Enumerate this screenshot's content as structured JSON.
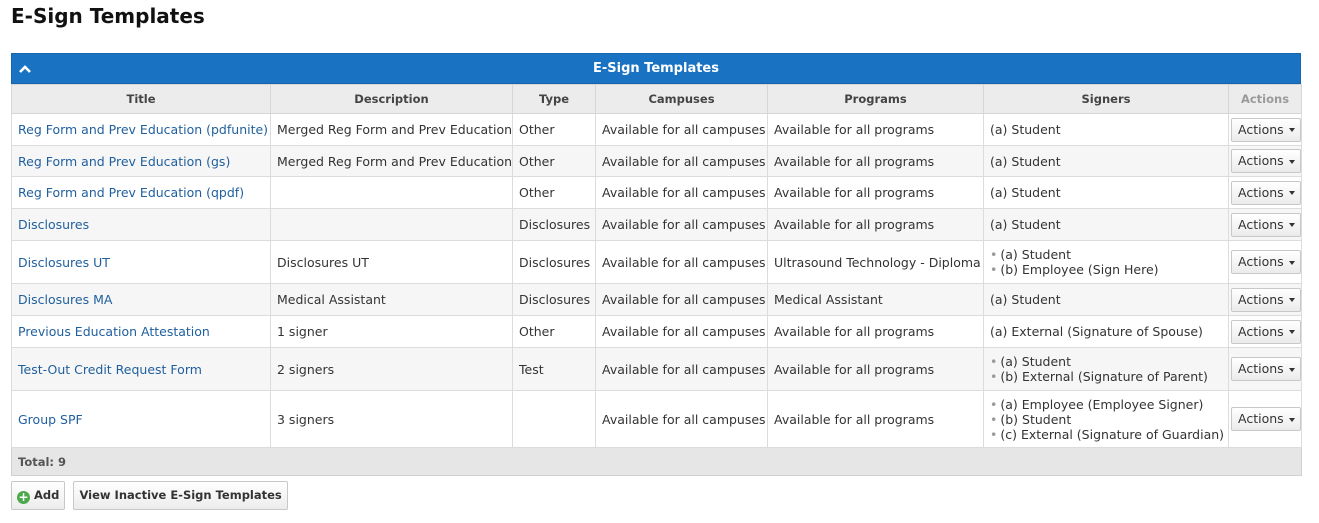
{
  "page": {
    "title": "E-Sign Templates"
  },
  "panel": {
    "title": "E-Sign Templates",
    "collapse_icon": "chevron-up-icon",
    "accent_color": "#1a73c2"
  },
  "table": {
    "columns": [
      "Title",
      "Description",
      "Type",
      "Campuses",
      "Programs",
      "Signers",
      "Actions"
    ],
    "action_label": "Actions",
    "rows": [
      {
        "title": "Reg Form and Prev Education (pdfunite)",
        "description": "Merged Reg Form and Prev Education",
        "type": "Other",
        "campuses": "Available for all campuses",
        "programs": "Available for all programs",
        "signers": [
          "(a) Student"
        ]
      },
      {
        "title": "Reg Form and Prev Education (gs)",
        "description": "Merged Reg Form and Prev Education",
        "type": "Other",
        "campuses": "Available for all campuses",
        "programs": "Available for all programs",
        "signers": [
          "(a) Student"
        ]
      },
      {
        "title": "Reg Form and Prev Education (qpdf)",
        "description": "",
        "type": "Other",
        "campuses": "Available for all campuses",
        "programs": "Available for all programs",
        "signers": [
          "(a) Student"
        ]
      },
      {
        "title": "Disclosures",
        "description": "",
        "type": "Disclosures",
        "campuses": "Available for all campuses",
        "programs": "Available for all programs",
        "signers": [
          "(a) Student"
        ]
      },
      {
        "title": "Disclosures UT",
        "description": "Disclosures UT",
        "type": "Disclosures",
        "campuses": "Available for all campuses",
        "programs": "Ultrasound Technology - Diploma",
        "signers": [
          "(a) Student",
          "(b) Employee (Sign Here)"
        ]
      },
      {
        "title": "Disclosures MA",
        "description": "Medical Assistant",
        "type": "Disclosures",
        "campuses": "Available for all campuses",
        "programs": "Medical Assistant",
        "signers": [
          "(a) Student"
        ]
      },
      {
        "title": "Previous Education Attestation",
        "description": "1 signer",
        "type": "Other",
        "campuses": "Available for all campuses",
        "programs": "Available for all programs",
        "signers": [
          "(a) External (Signature of Spouse)"
        ]
      },
      {
        "title": "Test-Out Credit Request Form",
        "description": "2 signers",
        "type": "Test",
        "campuses": "Available for all campuses",
        "programs": "Available for all programs",
        "signers": [
          "(a) Student",
          "(b) External (Signature of Parent)"
        ]
      },
      {
        "title": "Group SPF",
        "description": "3 signers",
        "type": "",
        "campuses": "Available for all campuses",
        "programs": "Available for all programs",
        "signers": [
          "(a) Employee (Employee Signer)",
          "(b) Student",
          "(c) External (Signature of Guardian)"
        ]
      }
    ],
    "total_label": "Total: 9"
  },
  "buttons": {
    "add_label": "Add",
    "add_icon": "plus-circle-icon",
    "view_inactive_label": "View Inactive E-Sign Templates"
  }
}
